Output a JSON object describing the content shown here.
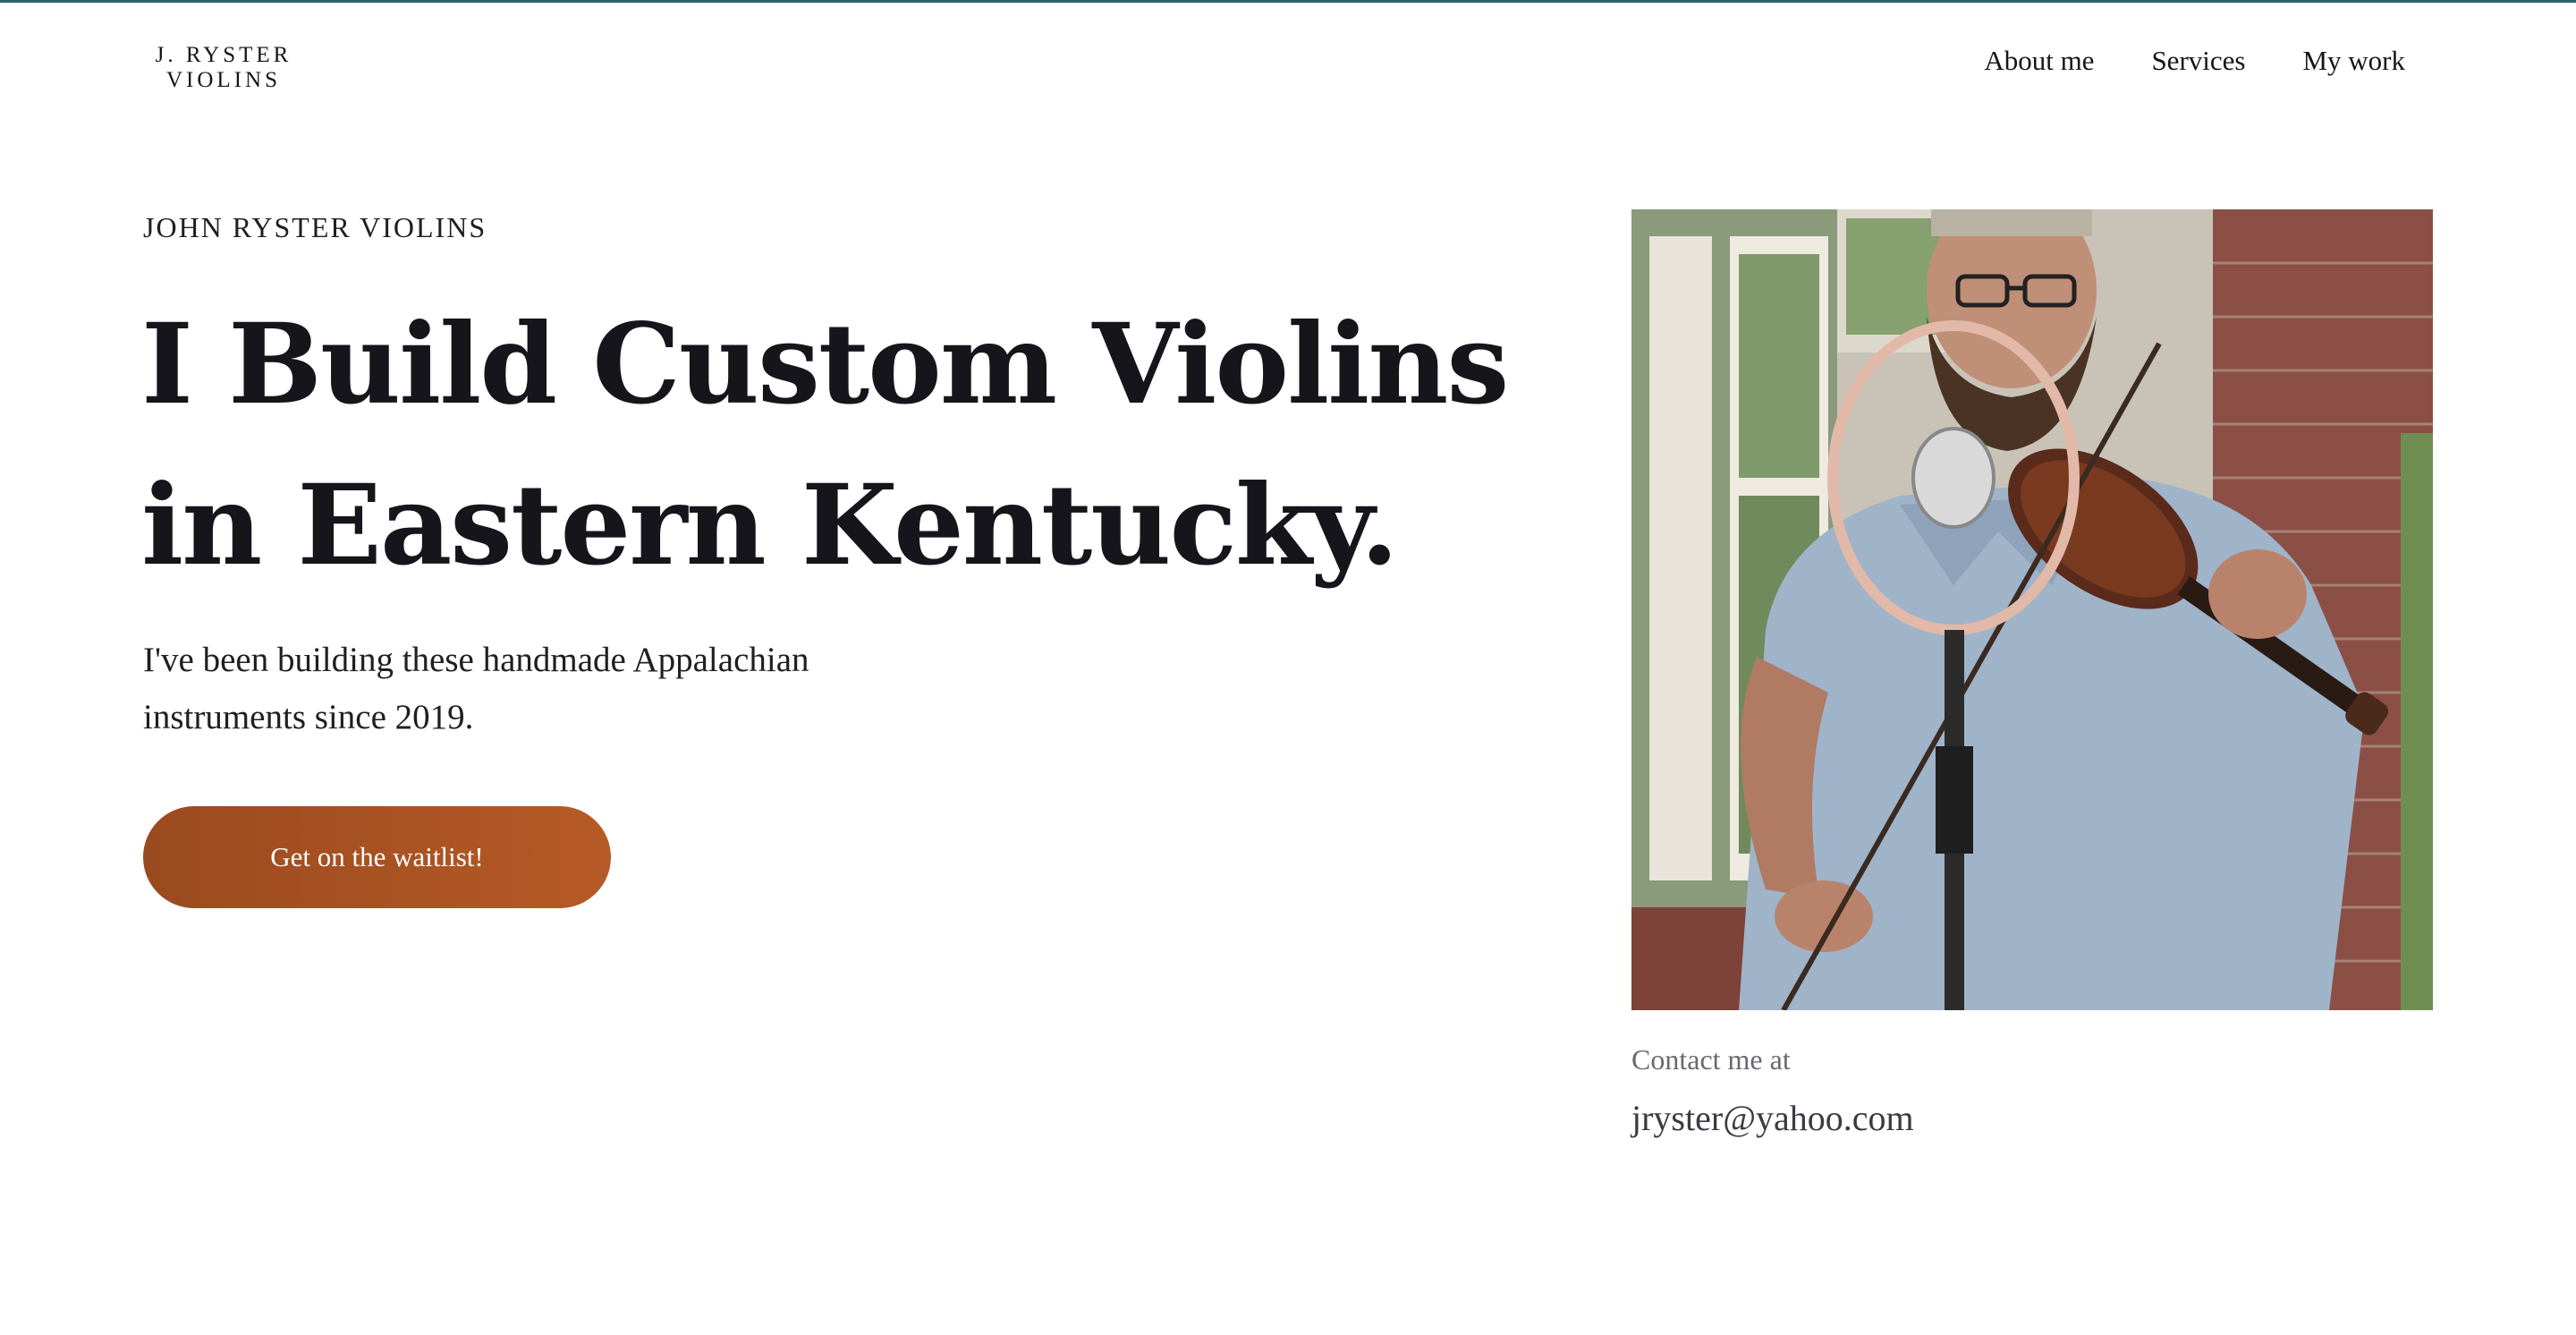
{
  "site": {
    "logo_line1": "J. RYSTER",
    "logo_line2": "VIOLINS",
    "accent_color": "#a9522a",
    "top_rule_color": "#2f5f6b"
  },
  "nav": {
    "items": [
      {
        "label": "About me"
      },
      {
        "label": "Services"
      },
      {
        "label": "My work"
      }
    ]
  },
  "hero": {
    "eyebrow": "JOHN RYSTER VIOLINS",
    "headline_line1": "I Build Custom Violins",
    "headline_line2": "in Eastern Kentucky.",
    "lede": "I've been building these handmade Appalachian instruments since 2019.",
    "cta_label": "Get on the waitlist!"
  },
  "photo": {
    "subject": "bearded man playing a violin in front of a ribbon microphone on a brick porch",
    "icon": "photo"
  },
  "contact": {
    "label": "Contact me at",
    "email": "jryster@yahoo.com"
  }
}
